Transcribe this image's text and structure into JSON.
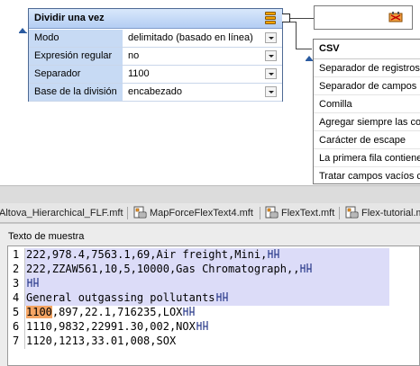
{
  "split_component": {
    "title": "Dividir una vez",
    "properties": [
      {
        "name": "Modo",
        "value": "delimitado (basado en línea)"
      },
      {
        "name": "Expresión regular",
        "value": "no"
      },
      {
        "name": "Separador",
        "value": "1100"
      },
      {
        "name": "Base de la división",
        "value": "encabezado"
      }
    ]
  },
  "csv_component": {
    "title": "CSV",
    "items": [
      "Separador de registros",
      "Separador de campos",
      "Comilla",
      "Agregar siempre las comillas",
      "Carácter de escape",
      "La primera fila contiene nombres",
      "Tratar campos vacíos como"
    ]
  },
  "tabs": [
    {
      "label": "Altova_Hierarchical_FLF.mft"
    },
    {
      "label": "MapForceFlexText4.mft"
    },
    {
      "label": "FlexText.mft"
    },
    {
      "label": "Flex-tutorial.mft"
    }
  ],
  "sample_panel": {
    "title": "Texto de muestra",
    "lines": [
      {
        "n": "1",
        "text": "222,978.4,7563.1,69,Air freight,Mini,"
      },
      {
        "n": "2",
        "text": "222,ZZAW561,10,5,10000,Gas Chromatograph,,"
      },
      {
        "n": "3",
        "text": ""
      },
      {
        "n": "4",
        "text": "General outgassing pollutants"
      },
      {
        "n": "5",
        "highlight": "1100",
        "text": ",897,22.1,716235,LOX"
      },
      {
        "n": "6",
        "text": "1110,9832,22991.30,002,NOX"
      },
      {
        "n": "7",
        "text": "1120,1213,33.01,008,SOX"
      }
    ]
  },
  "colors": {
    "header_gradient": "#b3cdf3",
    "property_name_bg": "#c7daf4",
    "menu_icon": "#f5a300",
    "selected_block": "#dcdcf8",
    "split_highlight": "#f5a564"
  }
}
